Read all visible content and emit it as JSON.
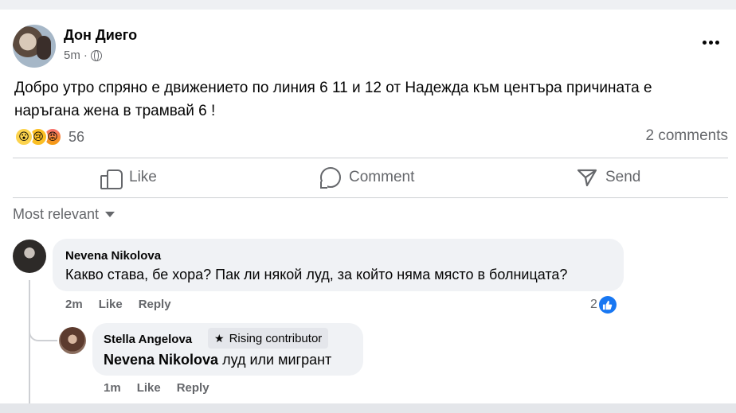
{
  "post": {
    "author": "Дон Диего",
    "time": "5m",
    "separator": "·",
    "text": "Добро утро спряно е движението по линия 6 11 и 12 от Надежда към центъра причината е наръгана жена в трамвай 6 !",
    "reactions": {
      "icons": [
        "wow-icon",
        "sad-icon",
        "angry-icon"
      ],
      "count": "56"
    },
    "comments_count": "2 comments"
  },
  "actions": {
    "like": "Like",
    "comment": "Comment",
    "send": "Send"
  },
  "sort": {
    "label": "Most relevant"
  },
  "comments": [
    {
      "author": "Nevena Nikolova",
      "text": "Какво става, бе хора? Пак ли някой луд, за който няма място в болницата?",
      "time": "2m",
      "like": "Like",
      "reply": "Reply",
      "likes": "2"
    },
    {
      "author": "Stella Angelova",
      "badge": "Rising contributor",
      "mention": "Nevena Nikolova",
      "text": " луд или мигрант",
      "time": "1m",
      "like": "Like",
      "reply": "Reply"
    }
  ],
  "colors": {
    "accent": "#1877f2",
    "muted": "#65676b",
    "bubble": "#f0f2f5"
  }
}
